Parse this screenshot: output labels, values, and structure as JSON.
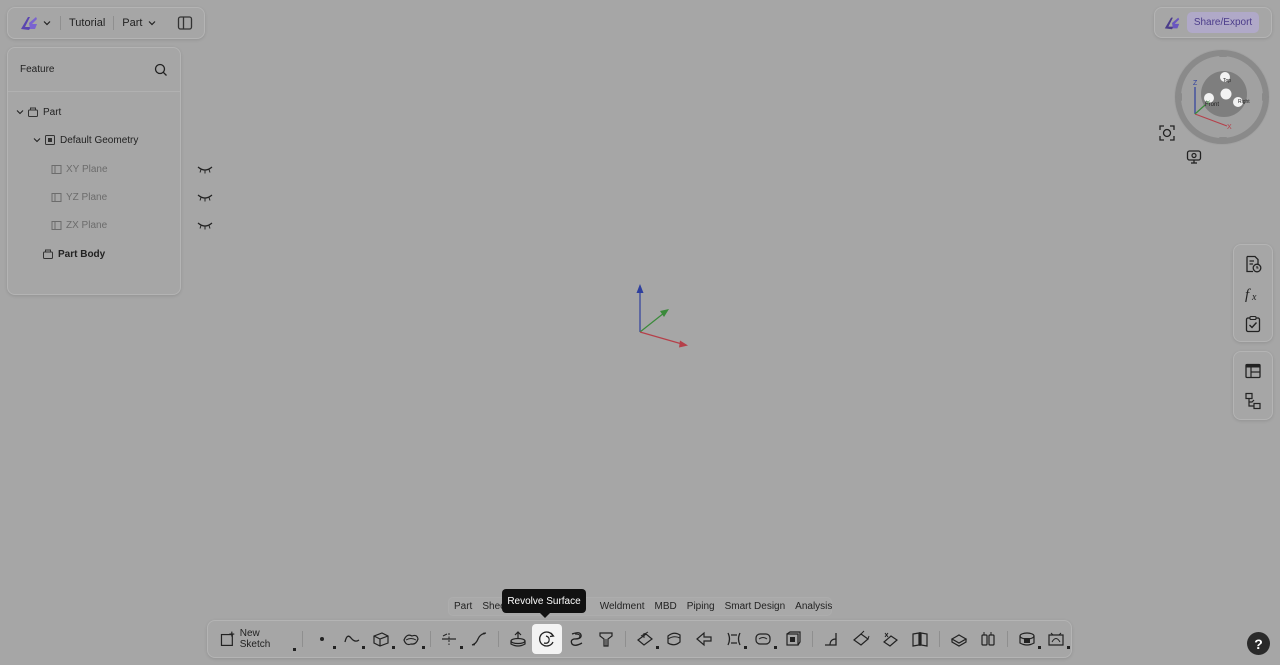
{
  "colors": {
    "background": "#a6a6a6",
    "accent": "#4b3c8a",
    "axis_x": "#b5404a",
    "axis_y": "#3a8a3a",
    "axis_z": "#2e3f9e"
  },
  "topbar": {
    "logo_icon": "app-logo-icon",
    "project": "Tutorial",
    "mode": "Part"
  },
  "feature_panel": {
    "title": "Feature",
    "tree": [
      {
        "label": "Part",
        "level": 0,
        "expanded": true
      },
      {
        "label": "Default Geometry",
        "level": 1,
        "expanded": true
      },
      {
        "label": "XY Plane",
        "level": 2,
        "hidden": true
      },
      {
        "label": "YZ Plane",
        "level": 2,
        "hidden": true
      },
      {
        "label": "ZX Plane",
        "level": 2,
        "hidden": true
      },
      {
        "label": "Part Body",
        "level": 1
      }
    ]
  },
  "share": {
    "label": "Share/Export"
  },
  "viewcube": {
    "faces": [
      "Top",
      "Front",
      "Right"
    ],
    "axes": [
      "Z",
      "Y",
      "X"
    ]
  },
  "tabs": [
    {
      "label": "Part"
    },
    {
      "label": "Shee"
    },
    {
      "label": "Weldment"
    },
    {
      "label": "MBD"
    },
    {
      "label": "Piping"
    },
    {
      "label": "Smart Design"
    },
    {
      "label": "Analysis"
    }
  ],
  "tooltip": "Revolve Surface",
  "toolbar": {
    "new_sketch": "New Sketch"
  },
  "help": "?"
}
